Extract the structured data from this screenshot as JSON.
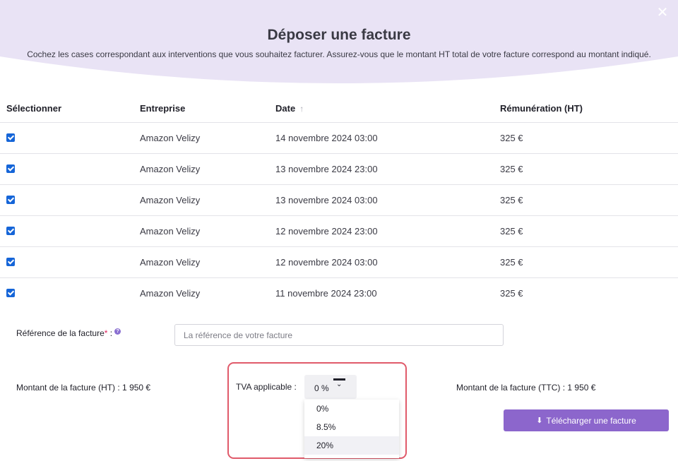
{
  "modal": {
    "title": "Déposer une facture",
    "subtitle": "Cochez les cases correspondant aux interventions que vous souhaitez facturer. Assurez-vous que le montant HT total de votre facture correspond au montant indiqué.",
    "close_icon": "close-icon",
    "header_color": "#e9e3f5"
  },
  "table": {
    "headers": {
      "select": "Sélectionner",
      "company": "Entreprise",
      "date": "Date",
      "remuneration": "Rémunération (HT)"
    },
    "date_sort_icon": "arrow-up-icon",
    "rows": [
      {
        "checked": true,
        "company": "Amazon Velizy",
        "date": "14 novembre 2024 03:00",
        "amount": "325 €"
      },
      {
        "checked": true,
        "company": "Amazon Velizy",
        "date": "13 novembre 2024 23:00",
        "amount": "325 €"
      },
      {
        "checked": true,
        "company": "Amazon Velizy",
        "date": "13 novembre 2024 03:00",
        "amount": "325 €"
      },
      {
        "checked": true,
        "company": "Amazon Velizy",
        "date": "12 novembre 2024 23:00",
        "amount": "325 €"
      },
      {
        "checked": true,
        "company": "Amazon Velizy",
        "date": "12 novembre 2024 03:00",
        "amount": "325 €"
      },
      {
        "checked": true,
        "company": "Amazon Velizy",
        "date": "11 novembre 2024 23:00",
        "amount": "325 €"
      }
    ]
  },
  "form": {
    "reference_label": "Référence de la facture",
    "reference_required": "*",
    "reference_suffix": " :",
    "reference_placeholder": "La référence de votre facture",
    "amount_ht": "Montant de la facture (HT) : 1 950 €",
    "amount_ttc": "Montant de la facture (TTC) : 1 950 €",
    "tva_label": "TVA applicable :",
    "tva_selected": "0 %",
    "tva_options": [
      "0%",
      "8.5%",
      "20%"
    ],
    "upload_button": "Télécharger une facture",
    "upload_icon": "download-icon",
    "accent_color": "#8c66cc",
    "highlight_color": "#e05a6a"
  }
}
